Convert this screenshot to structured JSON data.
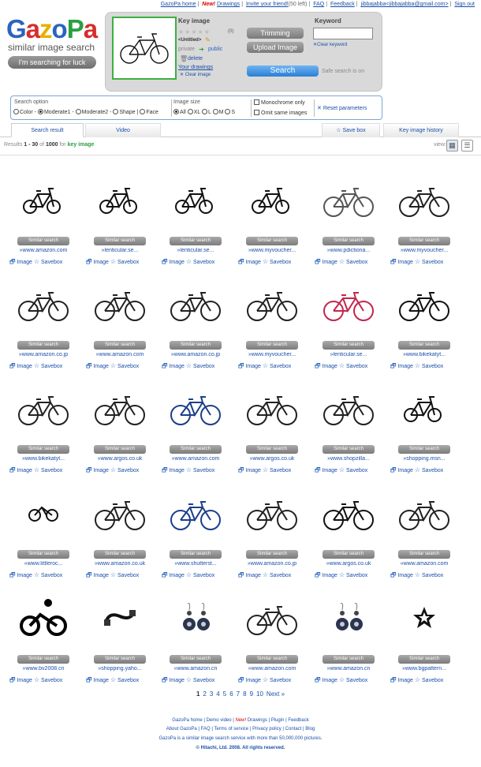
{
  "toplinks": {
    "home": "GazoPa home",
    "new": "New!",
    "drawings": "Drawings",
    "invite": "Invite your friend!",
    "invite_left": "(50 left)",
    "faq": "FAQ",
    "feedback": "Feedback",
    "user": "jibbajabba<jibbajabba@gmail.com>",
    "signout": "Sign out"
  },
  "logo": {
    "g": "G",
    "a": "a",
    "z": "z",
    "o": "o",
    "P": "P",
    "a2": "a"
  },
  "tagline": "similar image search",
  "luck_button": "I'm searching for luck",
  "key_image": {
    "label": "Key image",
    "stars": "★★★★★",
    "rating_count": "(0)",
    "name": "<Untitled>",
    "private": "private",
    "public": "public",
    "delete": "delete",
    "your_drawings": "Your drawings",
    "clear_image": "✕ Clear image"
  },
  "buttons": {
    "trimming": "Trimming",
    "upload": "Upload Image",
    "search": "Search"
  },
  "safe_search": "Safe search is on",
  "keyword": {
    "label": "Keyword",
    "value": "",
    "clear": "✕Clear keyword"
  },
  "options": {
    "search_option_label": "Search option",
    "search_options": [
      "Color",
      "Moderate1",
      "Moderate2",
      "Shape",
      "Face"
    ],
    "search_selected": "Moderate1",
    "size_label": "Image size",
    "sizes": [
      "All",
      "XL",
      "L",
      "M",
      "S"
    ],
    "size_selected": "All",
    "monochrome": "Monochrome only",
    "omit_same": "Omit same images",
    "reset": "Reset parameters"
  },
  "tabs": {
    "search_result": "Search result",
    "video": "Video",
    "save_box": "Save box",
    "history": "Key image history"
  },
  "results": {
    "prefix": "Results ",
    "range": "1 - 30",
    "of": " of ",
    "total": "1000",
    "for": " for ",
    "key": "key image"
  },
  "view_label": "view:",
  "action_labels": {
    "similar": "Similar search",
    "image": "Image",
    "savebox": "Savebox"
  },
  "items": [
    {
      "source": "www.amazon.com",
      "icon": "folding-bike-icon"
    },
    {
      "source": "lenticular.se...",
      "icon": "folding-bike-icon"
    },
    {
      "source": "lenticular.se...",
      "icon": "folding-bike-icon"
    },
    {
      "source": "www.myvoucher...",
      "icon": "folding-bike-icon"
    },
    {
      "source": "www.pdictiona...",
      "icon": "sketch-bike-icon"
    },
    {
      "source": "www.myvoucher...",
      "icon": "road-bike-icon"
    },
    {
      "source": "www.amazon.co.jp",
      "icon": "road-bike-icon"
    },
    {
      "source": "www.amazon.com",
      "icon": "road-bike-icon"
    },
    {
      "source": "www.amazon.co.jp",
      "icon": "road-bike-icon"
    },
    {
      "source": "www.myvoucher...",
      "icon": "road-bike-icon"
    },
    {
      "source": "lenticular.se...",
      "icon": "red-bike-icon"
    },
    {
      "source": "www.bikekatyt...",
      "icon": "bmx-bike-icon"
    },
    {
      "source": "www.bikekatyt...",
      "icon": "road-bike-icon"
    },
    {
      "source": "www.argos.co.uk",
      "icon": "road-bike-icon"
    },
    {
      "source": "www.amazon.com",
      "icon": "blue-bike-icon"
    },
    {
      "source": "www.argos.co.uk",
      "icon": "road-bike-icon"
    },
    {
      "source": "www.shopzilla...",
      "icon": "road-bike-icon"
    },
    {
      "source": "shopping.msn...",
      "icon": "folding-bike-icon"
    },
    {
      "source": "www.littleroc...",
      "icon": "logo-bike-icon"
    },
    {
      "source": "www.amazon.co.uk",
      "icon": "road-bike-icon"
    },
    {
      "source": "www.shutterst...",
      "icon": "blue-bike-icon"
    },
    {
      "source": "www.amazon.co.jp",
      "icon": "road-bike-icon"
    },
    {
      "source": "www.argos.co.uk",
      "icon": "bmx-bike-icon"
    },
    {
      "source": "www.amazon.com",
      "icon": "road-bike-icon"
    },
    {
      "source": "www.bv2008.cn",
      "icon": "cyclist-icon"
    },
    {
      "source": "shopping.yaho...",
      "icon": "handlebar-icon"
    },
    {
      "source": "www.amazon.cn",
      "icon": "earring-icon"
    },
    {
      "source": "www.amazon.com",
      "icon": "road-bike-icon"
    },
    {
      "source": "www.amazon.cn",
      "icon": "earring-icon"
    },
    {
      "source": "www.bgpattern...",
      "icon": "star-icon"
    }
  ],
  "pager": {
    "pages": [
      "1",
      "2",
      "3",
      "4",
      "5",
      "6",
      "7",
      "8",
      "9",
      "10"
    ],
    "current": "1",
    "next": "Next »"
  },
  "footer": {
    "line1": {
      "home": "GazoPa home",
      "demo": "Demo video",
      "new": "New!",
      "drawings": "Drawings",
      "plugin": "Plugin",
      "feedback": "Feedback"
    },
    "line2": {
      "about": "About GazoPa",
      "faq": "FAQ",
      "terms": "Terms of service",
      "privacy": "Privacy policy",
      "contact": "Contact",
      "blog": "Blog"
    },
    "line3": "GazoPa is a similar image search service with more than 50,000,000 pictures.",
    "copyright": "© Hitachi, Ltd. 2008. All rights reserved."
  }
}
